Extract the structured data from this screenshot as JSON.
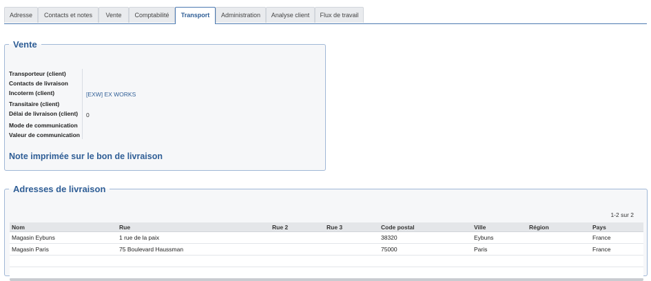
{
  "tabs": [
    {
      "label": "Adresse",
      "active": false
    },
    {
      "label": "Contacts et notes",
      "active": false
    },
    {
      "label": "Vente",
      "active": false
    },
    {
      "label": "Comptabilité",
      "active": false
    },
    {
      "label": "Transport",
      "active": true
    },
    {
      "label": "Administration",
      "active": false
    },
    {
      "label": "Analyse client",
      "active": false
    },
    {
      "label": "Flux de travail",
      "active": false
    }
  ],
  "vente": {
    "title": "Vente",
    "fields": [
      {
        "label": "Transporteur (client)",
        "value": ""
      },
      {
        "label": "Contacts de livraison",
        "value": ""
      },
      {
        "label": "Incoterm (client)",
        "value": "[EXW] EX WORKS"
      },
      {
        "label": "Transitaire (client)",
        "value": ""
      },
      {
        "label": "Délai de livraison (client)",
        "value": "0"
      },
      {
        "label": "Mode de communication",
        "value": ""
      },
      {
        "label": "Valeur de communication",
        "value": ""
      }
    ],
    "note_title": "Note imprimée sur le bon de livraison"
  },
  "livraison": {
    "title": "Adresses de livraison",
    "pager": "1-2 sur 2",
    "columns": [
      "Nom",
      "Rue",
      "Rue 2",
      "Rue 3",
      "Code postal",
      "Ville",
      "Région",
      "Pays"
    ],
    "rows": [
      [
        "Magasin Eybuns",
        "1 rue de la paix",
        "",
        "",
        "38320",
        "Eybuns",
        "",
        "France"
      ],
      [
        "Magasin Paris",
        "75 Boulevard Haussman",
        "",
        "",
        "75000",
        "Paris",
        "",
        "France"
      ]
    ]
  }
}
